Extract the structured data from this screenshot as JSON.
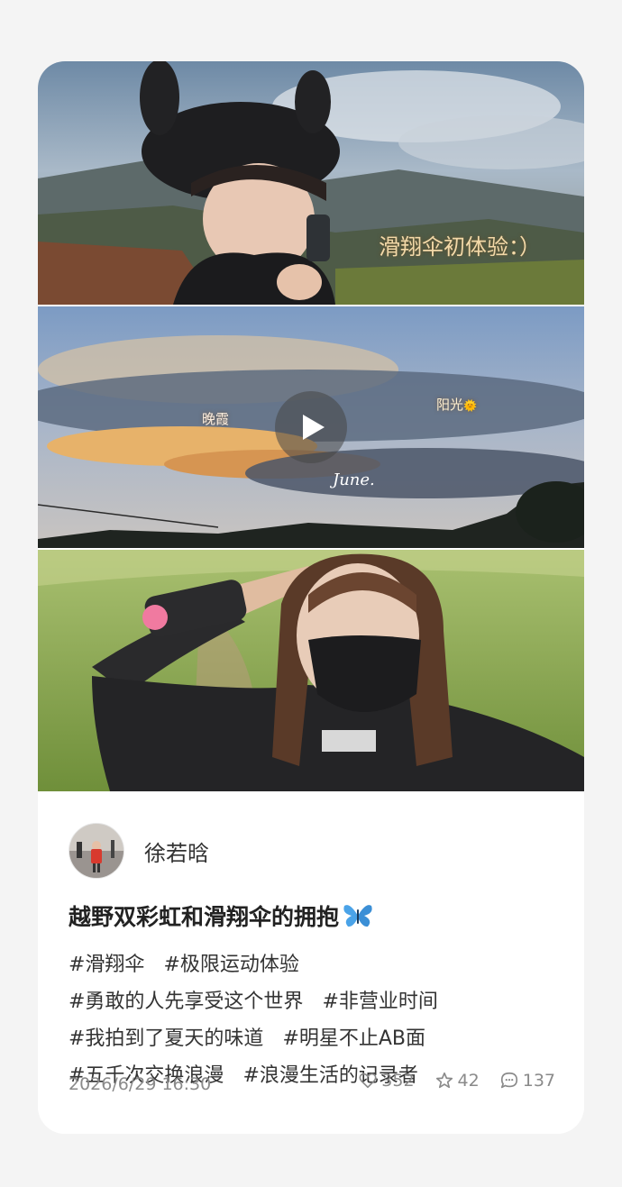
{
  "post": {
    "media": {
      "panel1_caption": "滑翔伞初体验：）",
      "panel2_label_left": "晚霞",
      "panel2_label_right": "阳光",
      "panel2_sun_emoji": "🌞",
      "panel2_script": "June."
    },
    "author": {
      "name": "徐若晗"
    },
    "title": "越野双彩虹和滑翔伞的拥抱",
    "title_icon": "butterfly-icon",
    "tags": [
      "#滑翔伞",
      "#极限运动体验",
      "#勇敢的人先享受这个世界",
      "#非营业时间",
      "#我拍到了夏天的味道",
      "#明星不止AB面",
      "#五千次交换浪漫",
      "#浪漫生活的记录者"
    ],
    "date": "2026/6/29 16:30",
    "stats": {
      "likes": "352",
      "favorites": "42",
      "comments": "137"
    }
  },
  "colors": {
    "card_bg": "#ffffff",
    "page_bg": "#f4f4f4",
    "butterfly": "#4aa3e8"
  }
}
